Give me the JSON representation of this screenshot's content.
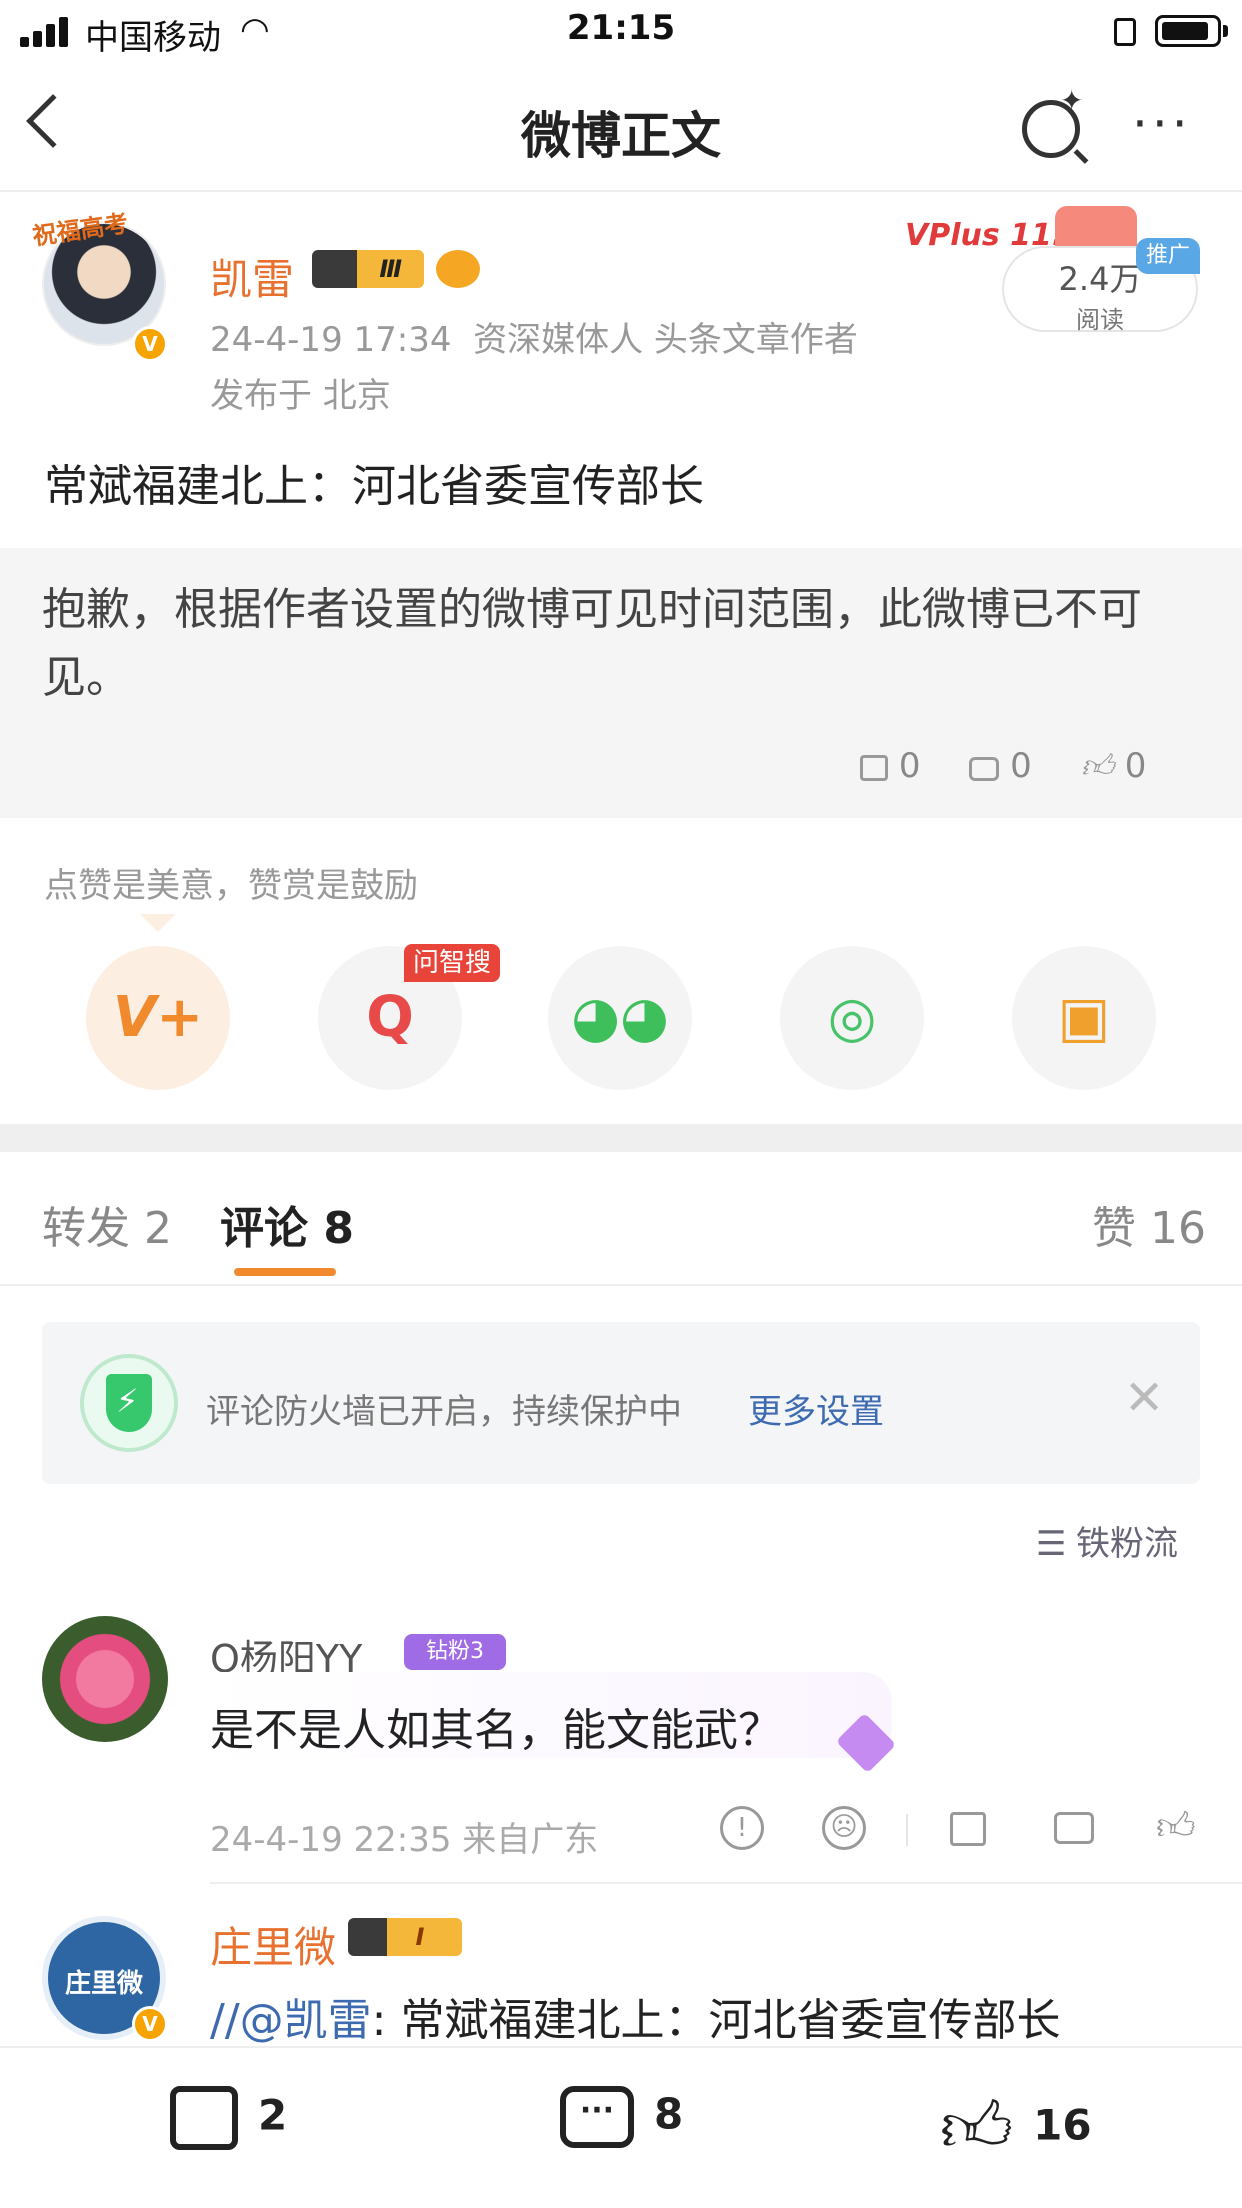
{
  "status_bar": {
    "carrier": "中国移动",
    "time": "21:15"
  },
  "nav": {
    "title": "微博正文"
  },
  "post": {
    "username": "凯雷",
    "crown_level": "Ⅲ",
    "avatar_badge": "祝福高考",
    "timestamp": "24-4-19 17:34",
    "author_tags": "资深媒体人 头条文章作者",
    "location": "发布于 北京",
    "text": "常斌福建北上：河北省委宣传部长",
    "vplus": "VPlus 11.11",
    "read_count": "2.4万",
    "read_label": "阅读",
    "promo_tag": "推广"
  },
  "retweet": {
    "text": "抱歉，根据作者设置的微博可见时间范围，此微博已不可见。",
    "reposts": "0",
    "comments": "0",
    "likes": "0"
  },
  "reward": {
    "note": "点赞是美意，赞赏是鼓励",
    "ai_search_tag": "问智搜",
    "share_targets": [
      {
        "icon": "v-plus-icon",
        "glyph": "V+"
      },
      {
        "icon": "ai-search-icon",
        "glyph": "Q"
      },
      {
        "icon": "wechat-icon",
        "glyph": "◕◕"
      },
      {
        "icon": "moments-icon",
        "glyph": "◎"
      },
      {
        "icon": "save-image-icon",
        "glyph": "▣"
      }
    ]
  },
  "tabs": {
    "repost": "转发 2",
    "comment": "评论 8",
    "like": "赞 16"
  },
  "firewall": {
    "text": "评论防火墙已开启，持续保护中",
    "link": "更多设置"
  },
  "sort": {
    "label": "铁粉流"
  },
  "comments": [
    {
      "name": "O杨阳YY",
      "fan_badge": "钻粉3",
      "text": "是不是人如其名，能文能武？",
      "meta": "24-4-19 22:35 来自广东"
    },
    {
      "name": "庄里微",
      "crown_level": "I",
      "avatar_text": "庄里微",
      "mention": "//@凯雷",
      "text": ": 常斌福建北上：河北省委宣传部长"
    }
  ],
  "bottom_bar": {
    "reposts": "2",
    "comments": "8",
    "likes": "16"
  }
}
